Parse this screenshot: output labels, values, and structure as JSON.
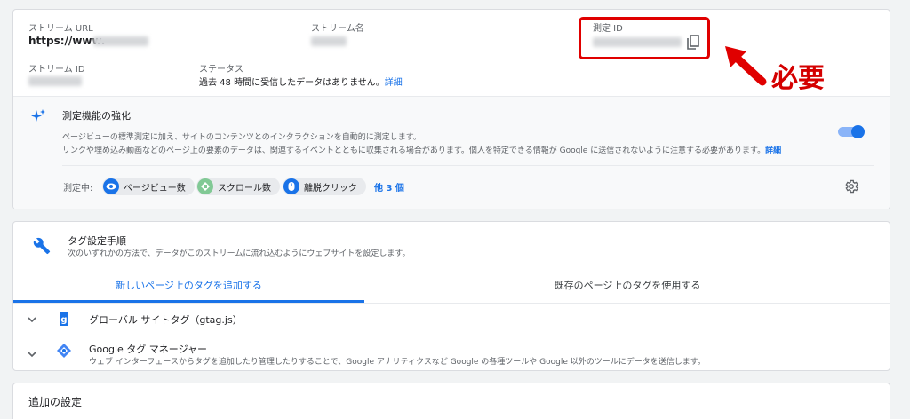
{
  "stream": {
    "url_label": "ストリーム URL",
    "url_value": "https://www.",
    "name_label": "ストリーム名",
    "id_label": "ストリーム ID",
    "status_label": "ステータス",
    "status_text": "過去 48 時間に受信したデータはありません。",
    "status_link": "詳細",
    "measurement_id_label": "測定 ID"
  },
  "enhanced": {
    "title": "測定機能の強化",
    "desc_line1": "ページビューの標準測定に加え、サイトのコンテンツとのインタラクションを自動的に測定します。",
    "desc_line2": "リンクや埋め込み動画などのページ上の要素のデータは、関連するイベントとともに収集される場合があります。個人を特定できる情報が Google に送信されないように注意する必要があります。",
    "desc_link": "詳細",
    "measuring_label": "測定中:",
    "chips": [
      {
        "label": "ページビュー数",
        "color": "#1a73e8"
      },
      {
        "label": "スクロール数",
        "color": "#81c995"
      },
      {
        "label": "離脱クリック",
        "color": "#1a73e8"
      }
    ],
    "more_link": "他 3 個"
  },
  "tags": {
    "title": "タグ設定手順",
    "subtitle": "次のいずれかの方法で、データがこのストリームに流れ込むようにウェブサイトを設定します。",
    "tab_active": "新しいページ上のタグを追加する",
    "tab_inactive": "既存のページ上のタグを使用する",
    "gtag_title": "グローバル サイトタグ（gtag.js）",
    "gtm_title": "Google タグ マネージャー",
    "gtm_desc": "ウェブ インターフェースからタグを追加したり管理したりすることで、Google アナリティクスなど Google の各種ツールや Google 以外のツールにデータを送信します。"
  },
  "additional": {
    "title": "追加の設定"
  },
  "annotation": {
    "text": "必要",
    "color": "#d40000"
  },
  "colors": {
    "accent": "#1a73e8",
    "text": "#202124",
    "muted": "#5f6368"
  }
}
